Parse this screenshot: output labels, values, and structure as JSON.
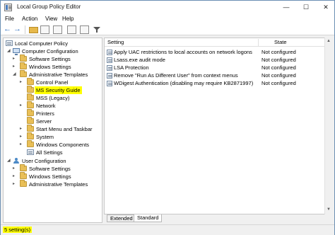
{
  "window": {
    "title": "Local Group Policy Editor",
    "controls": {
      "minimize": "—",
      "maximize": "☐",
      "close": "✕"
    }
  },
  "menu": [
    "File",
    "Action",
    "View",
    "Help"
  ],
  "toolbar": {
    "icons": [
      "back-arrow-icon",
      "forward-arrow-icon",
      "up-folder-icon",
      "show-hide-tree-icon",
      "export-list-icon",
      "help-icon",
      "properties-icon",
      "filter-icon"
    ]
  },
  "tree": {
    "root": "Local Computer Policy",
    "items": [
      {
        "label": "Computer Configuration",
        "icon": "computer-icon",
        "expanded": true
      },
      {
        "label": "Software Settings",
        "icon": "folder-icon",
        "expanded": false
      },
      {
        "label": "Windows Settings",
        "icon": "folder-icon",
        "expanded": false
      },
      {
        "label": "Administrative Templates",
        "icon": "folder-icon",
        "expanded": true
      },
      {
        "label": "Control Panel",
        "icon": "folder-icon",
        "expanded": false
      },
      {
        "label": "MS Security Guide",
        "icon": "folder-icon",
        "selected": true,
        "highlighted": true
      },
      {
        "label": "MSS (Legacy)",
        "icon": "folder-icon"
      },
      {
        "label": "Network",
        "icon": "folder-icon",
        "expanded": false
      },
      {
        "label": "Printers",
        "icon": "folder-icon"
      },
      {
        "label": "Server",
        "icon": "folder-icon"
      },
      {
        "label": "Start Menu and Taskbar",
        "icon": "folder-icon",
        "expanded": false
      },
      {
        "label": "System",
        "icon": "folder-icon",
        "expanded": false
      },
      {
        "label": "Windows Components",
        "icon": "folder-icon",
        "expanded": false
      },
      {
        "label": "All Settings",
        "icon": "policy-icon"
      },
      {
        "label": "User Configuration",
        "icon": "user-icon",
        "expanded": true
      },
      {
        "label": "Software Settings",
        "icon": "folder-icon",
        "expanded": false
      },
      {
        "label": "Windows Settings",
        "icon": "folder-icon",
        "expanded": false
      },
      {
        "label": "Administrative Templates",
        "icon": "folder-icon",
        "expanded": false
      }
    ]
  },
  "table": {
    "headers": {
      "setting": "Setting",
      "state": "State"
    },
    "rows": [
      {
        "setting": "Apply UAC restrictions to local accounts on network logons",
        "state": "Not configured"
      },
      {
        "setting": "Lsass.exe audit mode",
        "state": "Not configured"
      },
      {
        "setting": "LSA Protection",
        "state": "Not configured"
      },
      {
        "setting": "Remove \"Run As Different User\" from context menus",
        "state": "Not configured"
      },
      {
        "setting": "WDigest Authentication (disabling may require KB2871997)",
        "state": "Not configured"
      }
    ]
  },
  "tabs": {
    "extended": "Extended",
    "standard": "Standard",
    "active": "Standard"
  },
  "status": {
    "text": "5 setting(s)"
  },
  "colors": {
    "highlight": "#ffff00",
    "accent": "#2f6fbf",
    "folder": "#e9bf57"
  }
}
